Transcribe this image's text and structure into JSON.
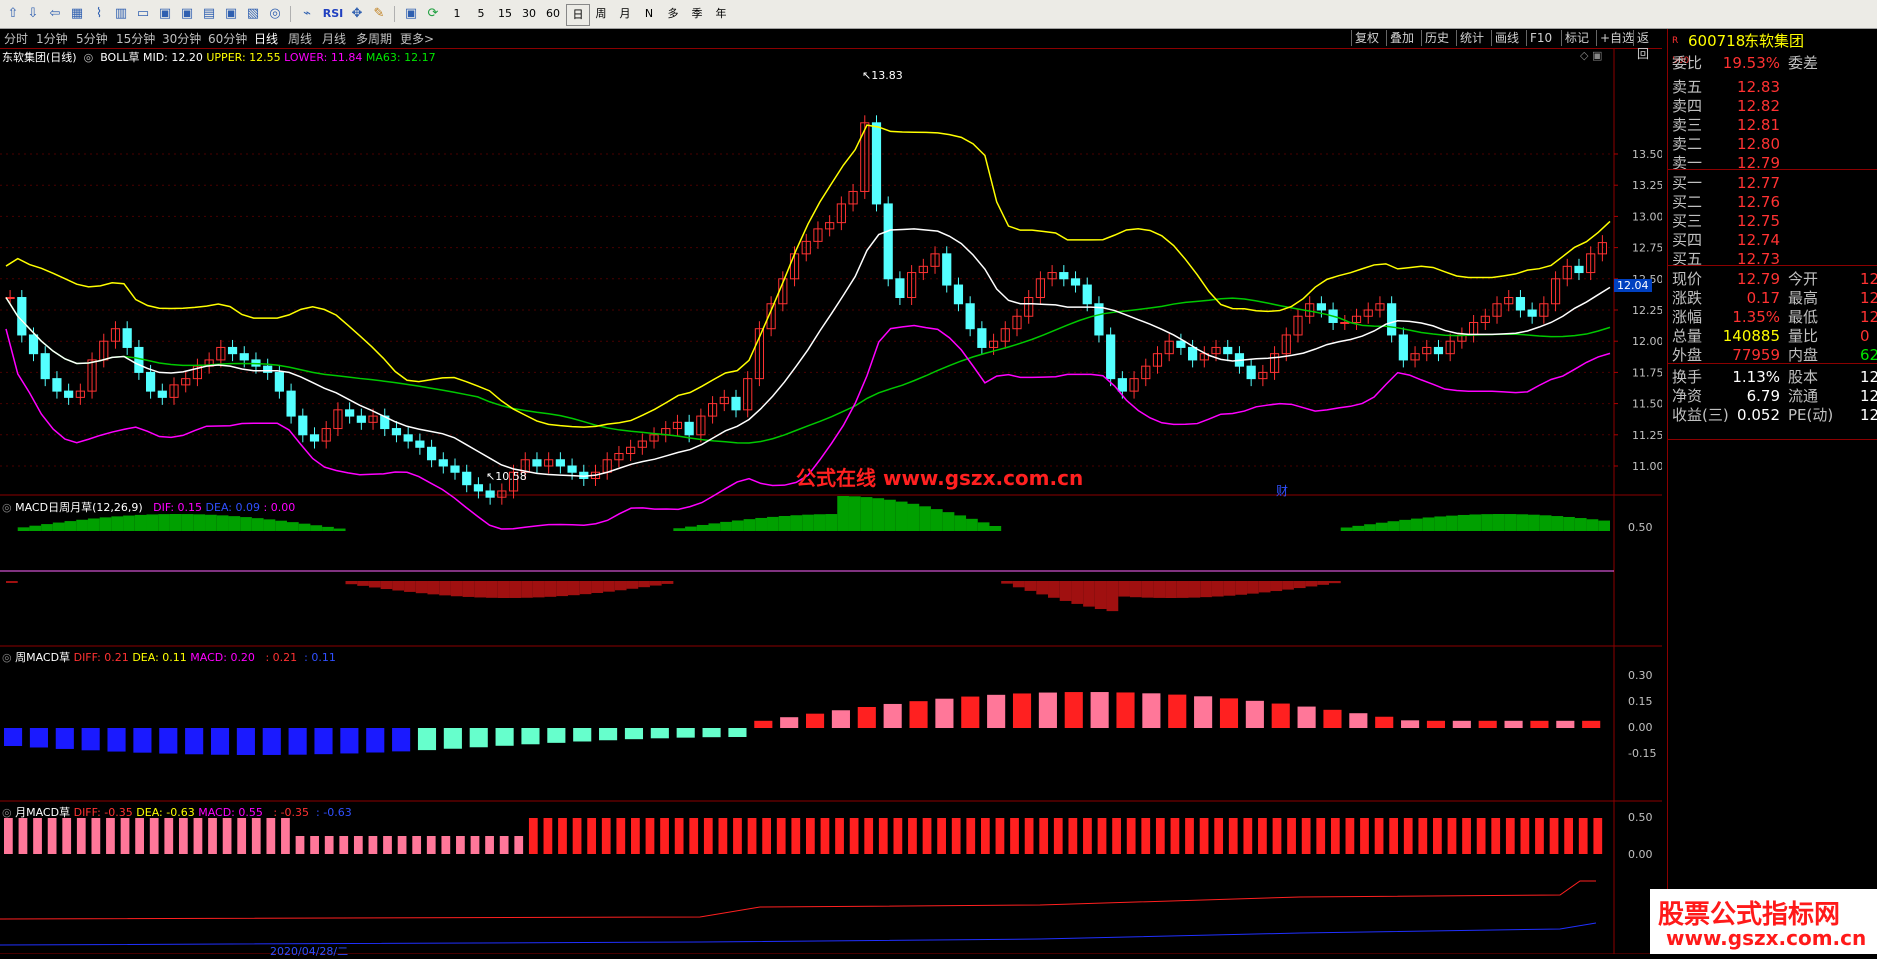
{
  "toolbar": {
    "buttons": [
      "1",
      "5",
      "15",
      "30",
      "60",
      "日",
      "周",
      "月",
      "N",
      "多",
      "季",
      "年"
    ],
    "rsi": "RSI"
  },
  "periods": [
    "分时",
    "1分钟",
    "5分钟",
    "15分钟",
    "30分钟",
    "60分钟",
    "日线",
    "周线",
    "月线",
    "多周期",
    "更多>"
  ],
  "right_tools": [
    "复权",
    "叠加",
    "历史",
    "统计",
    "画线",
    "F10",
    "标记",
    "+自选",
    "返回"
  ],
  "main_header": {
    "name": "东软集团(日线)",
    "ind": "BOLL草",
    "mid": "MID: 12.20",
    "upper": "UPPER: 12.55",
    "lower": "LOWER: 11.84",
    "ma63": "MA63: 12.17"
  },
  "price_axis": [
    "13.50",
    "13.25",
    "13.00",
    "12.75",
    "12.50",
    "12.25",
    "12.00",
    "11.75",
    "11.50",
    "11.25",
    "11.00"
  ],
  "current_price_tag": "12.04",
  "annotations": {
    "high": "13.83",
    "low": "10.58",
    "watermark": "公式在线  www.gszx.com.cn",
    "cai": "财"
  },
  "macd_panel": {
    "title": "MACD日周月草(12,26,9)",
    "dif": "DIF: 0.15",
    "dea": "DEA: 0.09",
    "macd": ": 0.00",
    "axis": [
      "0.50"
    ]
  },
  "week_panel": {
    "title": "周MACD草",
    "diff": "DIFF: 0.21",
    "dea": "DEA: 0.11",
    "macd": "MACD: 0.20",
    "v1": ": 0.21",
    "v2": ": 0.11",
    "axis": [
      "0.30",
      "0.15",
      "0.00",
      "-0.15"
    ]
  },
  "month_panel": {
    "title": "月MACD草",
    "diff": "DIFF: -0.35",
    "dea": "DEA: -0.63",
    "macd": "MACD: 0.55",
    "v1": ": -0.35",
    "v2": ": -0.63",
    "axis": [
      "0.50",
      "0.00"
    ]
  },
  "quote": {
    "code": "600718",
    "name": "东软集团",
    "weibi_label": "委比",
    "weibi": "19.53%",
    "weicha_label": "委差",
    "asks": [
      {
        "l": "卖五",
        "p": "12.83"
      },
      {
        "l": "卖四",
        "p": "12.82"
      },
      {
        "l": "卖三",
        "p": "12.81"
      },
      {
        "l": "卖二",
        "p": "12.80"
      },
      {
        "l": "卖一",
        "p": "12.79"
      }
    ],
    "bids": [
      {
        "l": "买一",
        "p": "12.77"
      },
      {
        "l": "买二",
        "p": "12.76"
      },
      {
        "l": "买三",
        "p": "12.75"
      },
      {
        "l": "买四",
        "p": "12.74"
      },
      {
        "l": "买五",
        "p": "12.73"
      }
    ],
    "stats": [
      {
        "l": "现价",
        "v": "12.79",
        "l2": "今开",
        "v2": "12"
      },
      {
        "l": "涨跌",
        "v": "0.17",
        "l2": "最高",
        "v2": "12"
      },
      {
        "l": "涨幅",
        "v": "1.35%",
        "l2": "最低",
        "v2": "12"
      },
      {
        "l": "总量",
        "v": "140885",
        "l2": "量比",
        "v2": "0"
      },
      {
        "l": "外盘",
        "v": "77959",
        "l2": "内盘",
        "v2": "62"
      }
    ],
    "stats2": [
      {
        "l": "换手",
        "v": "1.13%",
        "l2": "股本",
        "v2": "12."
      },
      {
        "l": "净资",
        "v": "6.79",
        "l2": "流通",
        "v2": "12."
      },
      {
        "l": "收益(三)",
        "v": "0.052",
        "l2": "PE(动)",
        "v2": "12"
      }
    ]
  },
  "watermark_box": {
    "line1": "股票公式指标网",
    "line2": "www.gszx.com.cn"
  },
  "bottom_dates": [
    "2020/04/28/二"
  ],
  "colors": {
    "up": "#ff3232",
    "down": "#54ffff",
    "upper": "#ffff00",
    "mid": "#ffffff",
    "lower": "#ff00ff",
    "ma63": "#00c800"
  }
}
